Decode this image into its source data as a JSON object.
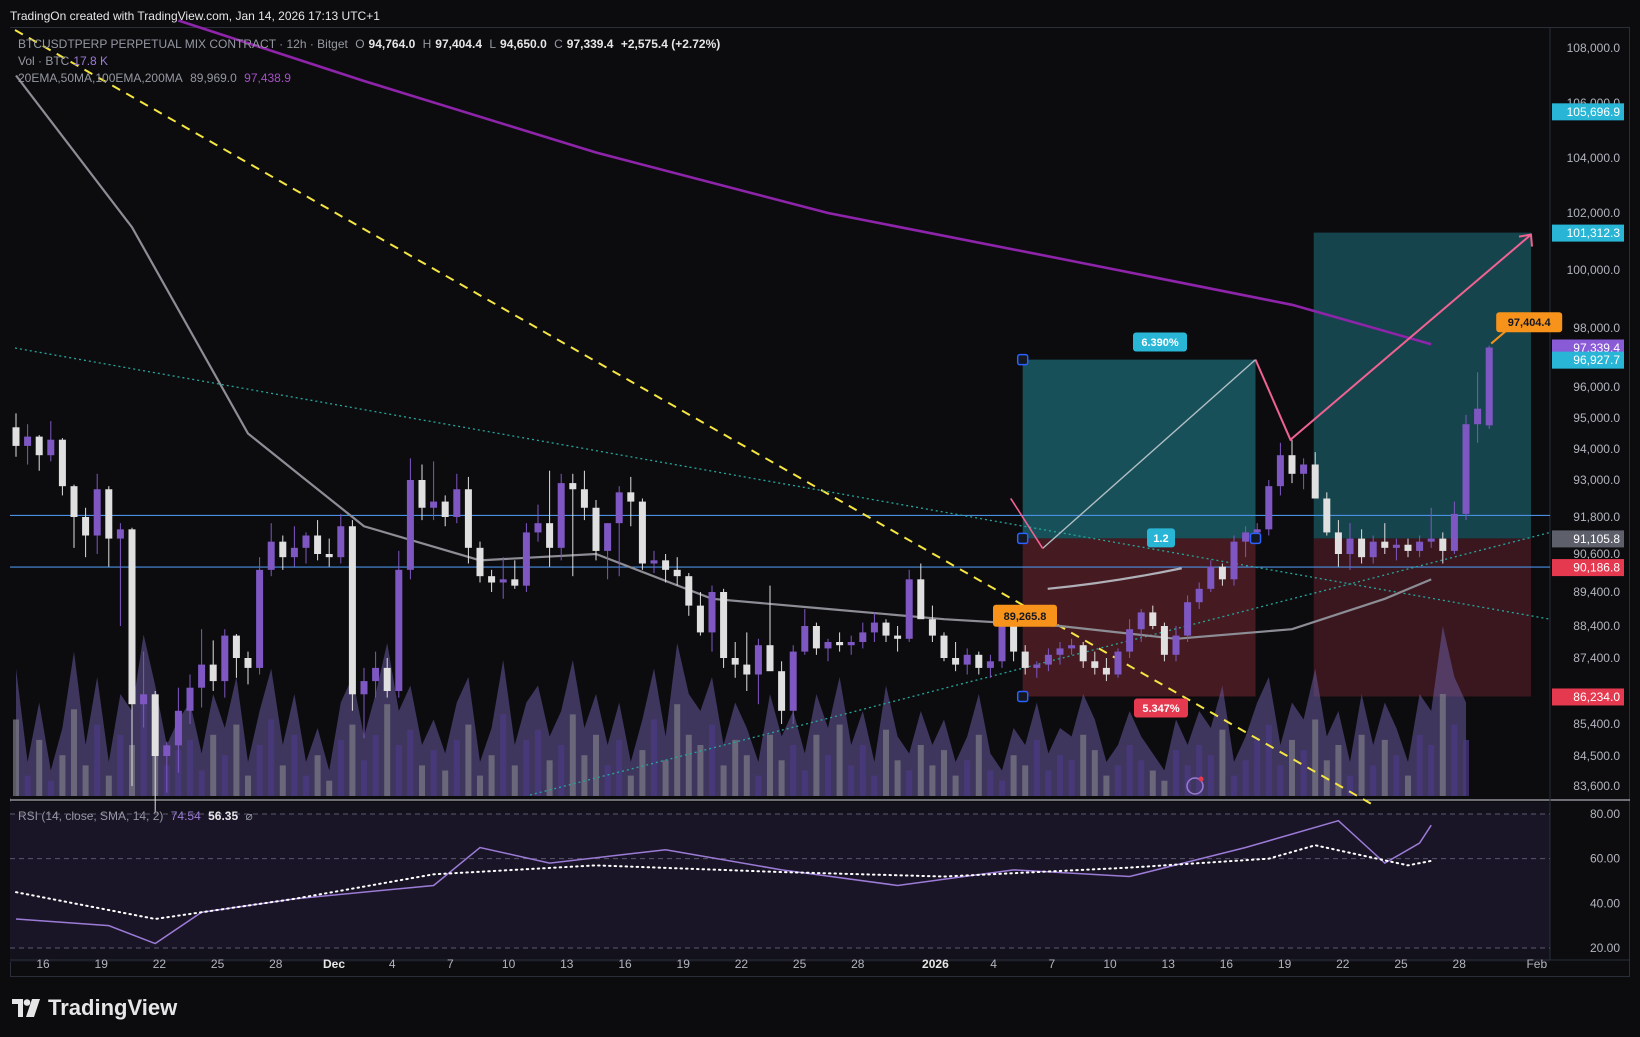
{
  "header": {
    "credit": "TradingOn created with TradingView.com, Jan 14, 2026 17:13 UTC+1"
  },
  "legend": {
    "symbol": "BTCUSDTPERP PERPETUAL MIX CONTRACT · 12h · Bitget",
    "o_label": "O",
    "o_val": "94,764.0",
    "h_label": "H",
    "h_val": "97,404.4",
    "l_label": "L",
    "l_val": "94,650.0",
    "c_label": "C",
    "c_val": "97,339.4",
    "change": "+2,575.4 (+2.72%)",
    "vol_label": "Vol · BTC",
    "vol_val": "17.8 K",
    "ma_label": "20EMA,50MA,100EMA,200MA",
    "ma_val1": "89,969.0",
    "ma_val2": "97,438.9",
    "rsi_label": "RSI (14, close, SMA, 14, 2)",
    "rsi_val1": "74.54",
    "rsi_val2": "56.35",
    "rsi_icon": "⌀"
  },
  "brand": {
    "name": "TradingView"
  },
  "colors": {
    "bg": "#0c0c0f",
    "up": "#7e57c2",
    "down": "#e0e0e0",
    "ma_gray": "#8d8d95",
    "ma_purple": "#8e24aa",
    "hline": "#4a90e2",
    "target_zone": "#1b5d66",
    "stop_zone": "#5a1f28",
    "label_orange": "#f7931a",
    "label_cyan": "#29b6d6",
    "label_red": "#e53950",
    "label_purple": "#8a5bd6",
    "pink_path": "#f06292",
    "yellow_dash": "#f5e642",
    "green_dot": "#26a69a"
  },
  "chart_data": {
    "type": "candlestick",
    "title": "BTCUSDTPERP PERPETUAL MIX CONTRACT · 12h · Bitget",
    "price_axis": [
      "108,000.0",
      "106,000.0",
      "104,000.0",
      "102,000.0",
      "100,000.0",
      "98,000.0",
      "96,000.0",
      "95,000.0",
      "94,000.0",
      "93,000.0",
      "91,800.0",
      "90,600.0",
      "89,400.0",
      "88,400.0",
      "87,400.0",
      "85,400.0",
      "84,500.0",
      "83,600.0"
    ],
    "price_axis_values": [
      108000,
      106000,
      104000,
      102000,
      100000,
      98000,
      96000,
      95000,
      94000,
      93000,
      91800,
      90600,
      89400,
      88400,
      87400,
      85400,
      84500,
      83600
    ],
    "time_axis": [
      "16",
      "19",
      "22",
      "25",
      "28",
      "Dec",
      "4",
      "7",
      "10",
      "13",
      "16",
      "19",
      "22",
      "25",
      "28",
      "2026",
      "4",
      "7",
      "10",
      "13",
      "16",
      "19",
      "22",
      "25",
      "28",
      "Feb"
    ],
    "time_axis_days": [
      0,
      3,
      6,
      9,
      12,
      15,
      18,
      21,
      24,
      27,
      30,
      33,
      36,
      39,
      42,
      46,
      49,
      52,
      55,
      58,
      61,
      64,
      67,
      70,
      73,
      77
    ],
    "rsi_axis": [
      "80.00",
      "60.00",
      "40.00",
      "20.00"
    ],
    "rsi_axis_values": [
      80,
      60,
      40,
      20
    ],
    "price_labels": [
      {
        "text": "105,696.9",
        "value": 105696.9,
        "color": "#29b6d6"
      },
      {
        "text": "101,312.3",
        "value": 101312.3,
        "color": "#29b6d6"
      },
      {
        "text": "97,339.4",
        "value": 97339.4,
        "color": "#8a5bd6"
      },
      {
        "text": "96,927.7",
        "value": 96927.7,
        "color": "#29b6d6"
      },
      {
        "text": "91,105.8",
        "value": 91105.8,
        "color": "#5d606b"
      },
      {
        "text": "90,186.8",
        "value": 90186.8,
        "color": "#e53950"
      },
      {
        "text": "86,234.0",
        "value": 86234.0,
        "color": "#e53950"
      }
    ],
    "annotations": {
      "high_label": "97,404.4",
      "low_label": "89,265.8",
      "target_pct": "6.390%",
      "stop_pct": "5.347%",
      "rr_ratio": "1.2"
    },
    "candles": [
      [
        94700,
        95150,
        93750,
        94100
      ],
      [
        94100,
        94800,
        93500,
        94400
      ],
      [
        94400,
        94450,
        93300,
        93800
      ],
      [
        93800,
        94900,
        93600,
        94300
      ],
      [
        94300,
        94350,
        92500,
        92800
      ],
      [
        92800,
        92850,
        90800,
        91800
      ],
      [
        91800,
        92100,
        90500,
        91200
      ],
      [
        91200,
        93200,
        90600,
        92700
      ],
      [
        92700,
        92800,
        90200,
        91100
      ],
      [
        91100,
        91600,
        88400,
        91400
      ],
      [
        91400,
        91450,
        83600,
        86000
      ],
      [
        86000,
        87600,
        85300,
        86300
      ],
      [
        86300,
        86400,
        82800,
        84500
      ],
      [
        84500,
        84900,
        83400,
        84800
      ],
      [
        84800,
        86500,
        84000,
        85800
      ],
      [
        85800,
        86900,
        85400,
        86500
      ],
      [
        86500,
        88300,
        85900,
        87200
      ],
      [
        87200,
        87950,
        86400,
        86700
      ],
      [
        86700,
        88300,
        86200,
        88100
      ],
      [
        88100,
        88150,
        86800,
        87400
      ],
      [
        87400,
        87600,
        86600,
        87100
      ],
      [
        87100,
        90500,
        86900,
        90100
      ],
      [
        90100,
        91600,
        89900,
        91000
      ],
      [
        91000,
        91200,
        90100,
        90500
      ],
      [
        90500,
        91500,
        90200,
        90800
      ],
      [
        90800,
        91300,
        90300,
        91200
      ],
      [
        91200,
        91700,
        90400,
        90600
      ],
      [
        90600,
        91100,
        90200,
        90500
      ],
      [
        90500,
        91900,
        90300,
        91500
      ],
      [
        91500,
        91700,
        85800,
        86300
      ],
      [
        86300,
        87100,
        85000,
        86700
      ],
      [
        86700,
        87600,
        86200,
        87100
      ],
      [
        87100,
        87400,
        86200,
        86400
      ],
      [
        86400,
        90700,
        86200,
        90100
      ],
      [
        90100,
        93700,
        89800,
        93000
      ],
      [
        93000,
        93500,
        91700,
        92100
      ],
      [
        92100,
        93600,
        91700,
        92300
      ],
      [
        92300,
        92500,
        91500,
        91800
      ],
      [
        91800,
        93200,
        91600,
        92700
      ],
      [
        92700,
        93100,
        90300,
        90800
      ],
      [
        90800,
        91000,
        89700,
        89900
      ],
      [
        89900,
        90100,
        89400,
        89700
      ],
      [
        89700,
        90500,
        89200,
        89800
      ],
      [
        89800,
        90400,
        89500,
        89600
      ],
      [
        89600,
        91600,
        89400,
        91300
      ],
      [
        91300,
        92200,
        91000,
        91600
      ],
      [
        91600,
        93300,
        90200,
        90800
      ],
      [
        90800,
        93200,
        90400,
        92900
      ],
      [
        92900,
        93200,
        89900,
        92700
      ],
      [
        92700,
        93300,
        91700,
        92100
      ],
      [
        92100,
        92350,
        90400,
        90700
      ],
      [
        90700,
        91600,
        89800,
        91600
      ],
      [
        91600,
        92800,
        89900,
        92600
      ],
      [
        92600,
        93100,
        91500,
        92300
      ],
      [
        92300,
        92400,
        90100,
        90300
      ],
      [
        90300,
        90700,
        90000,
        90400
      ],
      [
        90400,
        90600,
        89700,
        90100
      ],
      [
        90100,
        90500,
        89600,
        89900
      ],
      [
        89900,
        90000,
        88700,
        89000
      ],
      [
        89000,
        89400,
        88100,
        88200
      ],
      [
        88200,
        89600,
        87600,
        89400
      ],
      [
        89400,
        89500,
        87100,
        87400
      ],
      [
        87400,
        87900,
        86800,
        87200
      ],
      [
        87200,
        88200,
        86400,
        86900
      ],
      [
        86900,
        88000,
        86000,
        87800
      ],
      [
        87800,
        89600,
        87200,
        87000
      ],
      [
        87000,
        87300,
        85400,
        85800
      ],
      [
        85800,
        87800,
        85400,
        87600
      ],
      [
        87600,
        88900,
        87500,
        88400
      ],
      [
        88400,
        88500,
        87500,
        87700
      ],
      [
        87700,
        88000,
        87300,
        87900
      ],
      [
        87900,
        88200,
        87600,
        87800
      ],
      [
        87800,
        88100,
        87500,
        87900
      ],
      [
        87900,
        88500,
        87700,
        88200
      ],
      [
        88200,
        88800,
        87900,
        88500
      ],
      [
        88500,
        88600,
        87900,
        88100
      ],
      [
        88100,
        88400,
        87600,
        88000
      ],
      [
        88000,
        90100,
        87900,
        89800
      ],
      [
        89800,
        90300,
        88700,
        88600
      ],
      [
        88600,
        89000,
        87900,
        88100
      ],
      [
        88100,
        88200,
        87300,
        87400
      ],
      [
        87400,
        87900,
        87000,
        87200
      ],
      [
        87200,
        87700,
        86900,
        87500
      ],
      [
        87500,
        87600,
        86900,
        87100
      ],
      [
        87100,
        87500,
        86800,
        87300
      ],
      [
        87300,
        88600,
        87100,
        88400
      ],
      [
        88400,
        88700,
        87300,
        87600
      ],
      [
        87600,
        87800,
        86900,
        87100
      ],
      [
        87100,
        87300,
        86800,
        87200
      ],
      [
        87200,
        87700,
        87000,
        87500
      ],
      [
        87500,
        87900,
        87200,
        87700
      ],
      [
        87700,
        88000,
        87500,
        87800
      ],
      [
        87800,
        87900,
        87100,
        87300
      ],
      [
        87300,
        87600,
        86900,
        87100
      ],
      [
        87100,
        87400,
        86700,
        86900
      ],
      [
        86900,
        87700,
        86800,
        87600
      ],
      [
        87600,
        88600,
        87400,
        88300
      ],
      [
        88300,
        88900,
        87900,
        88800
      ],
      [
        88800,
        89000,
        88300,
        88400
      ],
      [
        88400,
        88500,
        87300,
        87500
      ],
      [
        87500,
        88400,
        87300,
        88100
      ],
      [
        88100,
        89300,
        87900,
        89100
      ],
      [
        89100,
        89700,
        88900,
        89500
      ],
      [
        89500,
        90400,
        89400,
        90200
      ],
      [
        90200,
        90300,
        89600,
        89800
      ],
      [
        89800,
        91200,
        89600,
        91000
      ],
      [
        91000,
        91500,
        90500,
        91300
      ],
      [
        91300,
        91600,
        91000,
        91400
      ],
      [
        91400,
        93000,
        91200,
        92800
      ],
      [
        92800,
        94200,
        92500,
        93800
      ],
      [
        93800,
        94300,
        92900,
        93200
      ],
      [
        93200,
        93700,
        92700,
        93500
      ],
      [
        93500,
        93900,
        92900,
        92400
      ],
      [
        92400,
        92600,
        91200,
        91300
      ],
      [
        91300,
        91700,
        90200,
        90600
      ],
      [
        90600,
        91600,
        90100,
        91100
      ],
      [
        91100,
        91400,
        90300,
        90500
      ],
      [
        90500,
        91200,
        90300,
        91000
      ],
      [
        91000,
        91600,
        90600,
        90800
      ],
      [
        90800,
        91100,
        90400,
        90900
      ],
      [
        90900,
        91100,
        90500,
        90700
      ],
      [
        90700,
        91200,
        90500,
        91000
      ],
      [
        91000,
        92100,
        90800,
        91100
      ],
      [
        91100,
        91300,
        90300,
        90700
      ],
      [
        90700,
        92300,
        90600,
        91900
      ],
      [
        91900,
        95100,
        91700,
        94800
      ],
      [
        94800,
        96500,
        94200,
        95300
      ],
      [
        94764,
        97404.4,
        94650,
        97339.4
      ]
    ],
    "volume": [
      0.75,
      0.2,
      0.55,
      0.15,
      0.4,
      0.85,
      0.3,
      0.7,
      0.2,
      0.6,
      0.5,
      0.95,
      0.65,
      0.3,
      0.45,
      0.55,
      0.25,
      0.6,
      0.4,
      0.7,
      0.2,
      0.5,
      0.75,
      0.3,
      0.6,
      0.2,
      0.4,
      0.15,
      0.55,
      0.7,
      0.35,
      0.6,
      0.9,
      0.5,
      0.65,
      0.3,
      0.45,
      0.25,
      0.55,
      0.7,
      0.2,
      0.4,
      0.8,
      0.3,
      0.55,
      0.65,
      0.35,
      0.5,
      0.8,
      0.4,
      0.6,
      0.3,
      0.55,
      0.2,
      0.45,
      0.75,
      0.35,
      0.9,
      0.6,
      0.5,
      0.7,
      0.3,
      0.55,
      0.4,
      0.2,
      0.6,
      0.35,
      0.5,
      0.25,
      0.6,
      0.4,
      0.7,
      0.3,
      0.5,
      0.2,
      0.65,
      0.35,
      0.25,
      0.5,
      0.3,
      0.45,
      0.2,
      0.35,
      0.6,
      0.25,
      0.15,
      0.4,
      0.3,
      0.55,
      0.25,
      0.4,
      0.35,
      0.6,
      0.45,
      0.2,
      0.3,
      0.5,
      0.35,
      0.25,
      0.15,
      0.45,
      0.3,
      0.5,
      0.4,
      0.65,
      0.2,
      0.35,
      0.55,
      0.7,
      0.3,
      0.55,
      0.45,
      0.75,
      0.35,
      0.5,
      0.2,
      0.6,
      0.3,
      0.55,
      0.4,
      0.2,
      0.6,
      0.5,
      1.0,
      0.7,
      0.55
    ],
    "ma_gray": [
      [
        0,
        107000
      ],
      [
        10,
        101500
      ],
      [
        20,
        94500
      ],
      [
        25,
        93000
      ],
      [
        30,
        91500
      ],
      [
        40,
        90400
      ],
      [
        50,
        90600
      ],
      [
        60,
        89200
      ],
      [
        70,
        88900
      ],
      [
        80,
        88600
      ],
      [
        90,
        88400
      ],
      [
        100,
        88000
      ],
      [
        110,
        88300
      ],
      [
        118,
        89200
      ],
      [
        122,
        89800
      ]
    ],
    "ma_purple": [
      [
        14,
        109000
      ],
      [
        30,
        106800
      ],
      [
        50,
        104200
      ],
      [
        70,
        102000
      ],
      [
        90,
        100400
      ],
      [
        110,
        98800
      ],
      [
        122,
        97450
      ]
    ],
    "rsi": [
      [
        0,
        33
      ],
      [
        8,
        30
      ],
      [
        12,
        22
      ],
      [
        16,
        36
      ],
      [
        24,
        42
      ],
      [
        36,
        48
      ],
      [
        40,
        65
      ],
      [
        46,
        58
      ],
      [
        56,
        64
      ],
      [
        66,
        55
      ],
      [
        76,
        48
      ],
      [
        86,
        55
      ],
      [
        96,
        52
      ],
      [
        106,
        65
      ],
      [
        114,
        77
      ],
      [
        118,
        58
      ],
      [
        121,
        67
      ],
      [
        122,
        75
      ]
    ],
    "rsi_ma": [
      [
        0,
        45
      ],
      [
        12,
        33
      ],
      [
        24,
        42
      ],
      [
        36,
        53
      ],
      [
        50,
        57
      ],
      [
        66,
        54
      ],
      [
        80,
        52
      ],
      [
        96,
        56
      ],
      [
        108,
        60
      ],
      [
        112,
        66
      ],
      [
        120,
        57
      ],
      [
        122,
        59
      ]
    ]
  }
}
